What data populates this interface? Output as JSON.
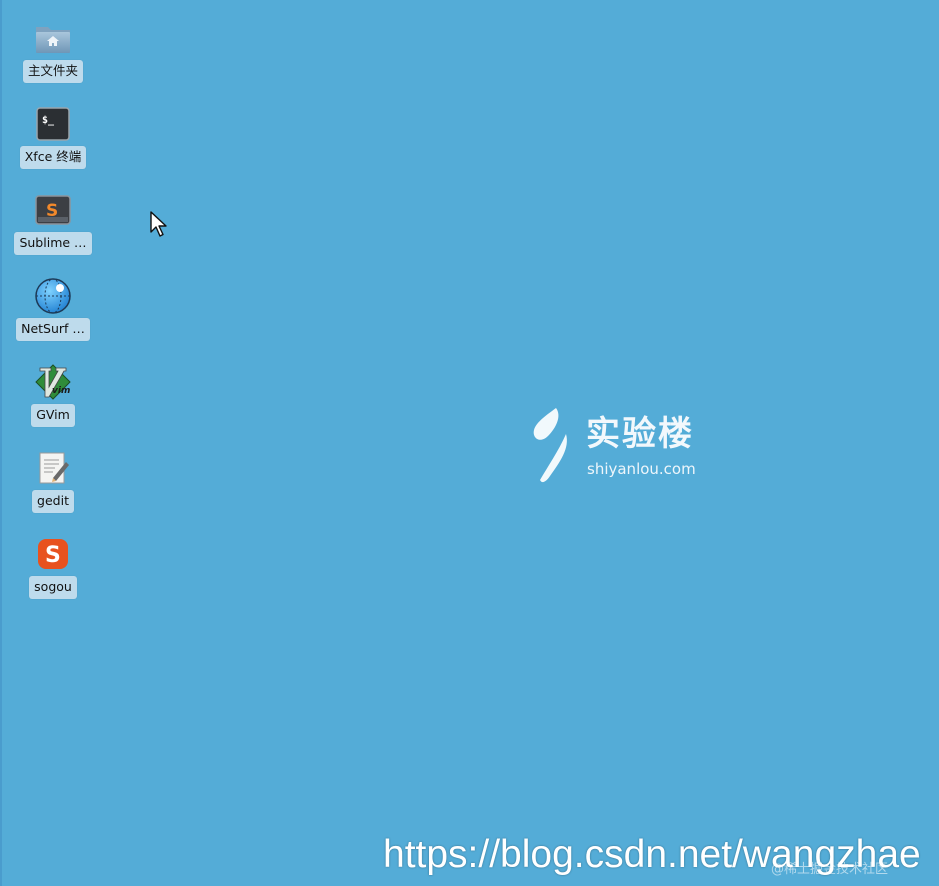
{
  "desktop": {
    "background_color": "#54acd7",
    "icons": [
      {
        "label": "主文件夹",
        "icon": "home-folder-icon"
      },
      {
        "label": "Xfce 终端",
        "icon": "terminal-icon",
        "glyph": "$_"
      },
      {
        "label": "Sublime …",
        "icon": "sublime-text-icon",
        "glyph": "S"
      },
      {
        "label": "NetSurf …",
        "icon": "netsurf-globe-icon"
      },
      {
        "label": "GVim",
        "icon": "gvim-icon",
        "glyph": "vim"
      },
      {
        "label": "gedit",
        "icon": "gedit-icon"
      },
      {
        "label": "sogou",
        "icon": "sogou-icon",
        "glyph": "S"
      }
    ]
  },
  "logo": {
    "name_cn": "实验楼",
    "domain": "shiyanlou.com"
  },
  "watermark": {
    "url": "https://blog.csdn.net/wangzhae",
    "credit": "@稀土掘金技术社区"
  }
}
